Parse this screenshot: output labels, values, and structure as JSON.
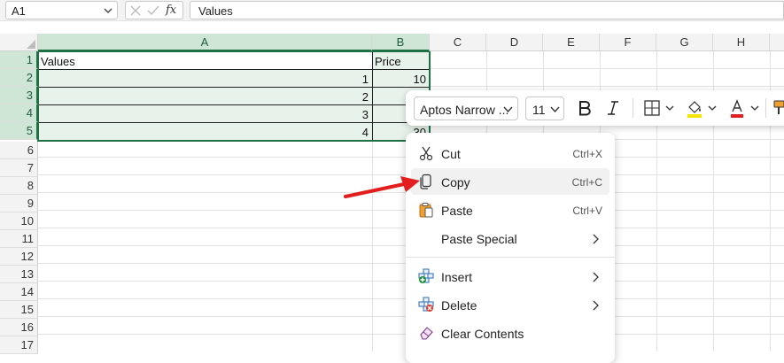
{
  "formula_bar": {
    "name_box": "A1",
    "fx_label": "fx",
    "formula_value": "Values"
  },
  "columns": [
    "A",
    "B",
    "C",
    "D",
    "E",
    "F",
    "G",
    "H"
  ],
  "rows": [
    "1",
    "2",
    "3",
    "4",
    "5",
    "6",
    "7",
    "8",
    "9",
    "10",
    "11",
    "12",
    "13",
    "14",
    "15",
    "16",
    "17"
  ],
  "cells": {
    "a1": "Values",
    "b1": "Price",
    "a2": "1",
    "b2": "10",
    "a3": "2",
    "a4": "3",
    "a5": "4",
    "b5": "30"
  },
  "mini_toolbar": {
    "font_name": "Aptos Narrow ...",
    "font_size": "11",
    "fill_color": "#f5e600",
    "font_color": "#e02020"
  },
  "context_menu": {
    "items": [
      {
        "label": "Cut",
        "shortcut": "Ctrl+X"
      },
      {
        "label": "Copy",
        "shortcut": "Ctrl+C"
      },
      {
        "label": "Paste",
        "shortcut": "Ctrl+V"
      },
      {
        "label": "Paste Special"
      },
      {
        "label": "Insert"
      },
      {
        "label": "Delete"
      },
      {
        "label": "Clear Contents"
      }
    ]
  },
  "colors": {
    "selection_border": "#1e7145",
    "selection_fill": "#e6f2ea",
    "arrow": "#e31e1e"
  }
}
